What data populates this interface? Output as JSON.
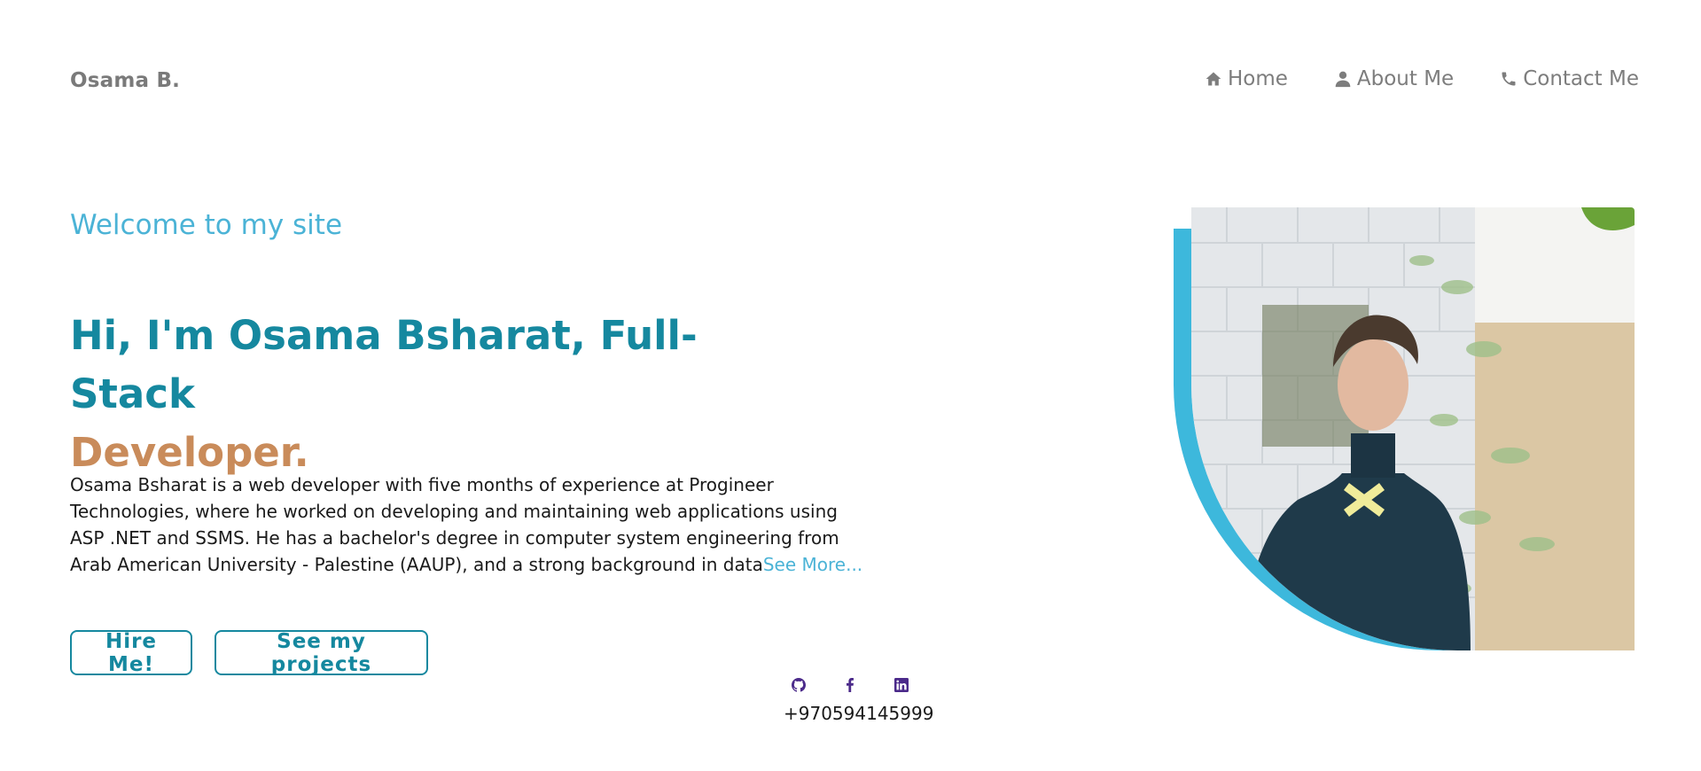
{
  "header": {
    "brand": "Osama B.",
    "nav": [
      {
        "label": "Home",
        "icon": "home-icon"
      },
      {
        "label": "About Me",
        "icon": "user-icon"
      },
      {
        "label": "Contact Me",
        "icon": "phone-icon"
      }
    ]
  },
  "hero": {
    "welcome": "Welcome to my site",
    "headline_main": "Hi, I'm Osama Bsharat, Full-Stack",
    "headline_accent": "Developer.",
    "bio_lines": [
      "Osama Bsharat is a web developer with five months of experience at Progineer",
      "Technologies, where he worked on developing and maintaining web applications using",
      "ASP .NET and SSMS. He has a bachelor's degree in computer system engineering from",
      "Arab American University - Palestine (AAUP), and a strong background in data"
    ],
    "see_more": "See More..."
  },
  "buttons": {
    "hire": "Hire Me!",
    "projects": "See my projects"
  },
  "contact": {
    "social_icons": [
      "github-icon",
      "facebook-icon",
      "linkedin-icon"
    ],
    "phone": "+970594145999"
  },
  "colors": {
    "primary": "#15889f",
    "accent": "#c98b5a",
    "light_blue": "#4bb3d6",
    "nav_gray": "#7d7d7d",
    "social_purple": "#4b2a8a"
  },
  "photo": {
    "icon": "portrait-photo"
  }
}
